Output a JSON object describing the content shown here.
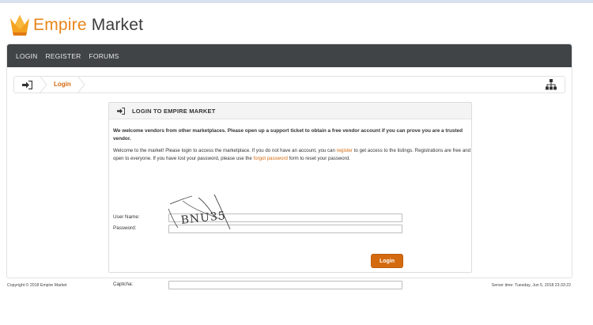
{
  "brand": {
    "name_part1": "Empire",
    "name_part2": "Market",
    "accent_color": "#e8851a"
  },
  "nav": {
    "items": [
      {
        "label": "LOGIN"
      },
      {
        "label": "REGISTER"
      },
      {
        "label": "FORUMS"
      }
    ]
  },
  "breadcrumb": {
    "home_icon": "sign-in-icon",
    "current": "Login",
    "right_icon": "sitemap-icon"
  },
  "panel": {
    "icon": "sign-in-icon",
    "title": "LOGIN TO EMPIRE MARKET",
    "notice": "We welcome vendors from other marketplaces. Please open up a support ticket to obtain a free vendor account if you can prove you are a trusted vendor.",
    "intro_1": "Welcome to the market! Please login to access the marketplace. If you do not have an account, you can ",
    "register_link": "register",
    "intro_2": " to get access to the listings. Registrations are free and open to everyone. If you have lost your password, please use the ",
    "forgot_link": "forgot password",
    "intro_3": " form to reset your password."
  },
  "form": {
    "username_label": "User Name:",
    "username_value": "",
    "password_label": "Password:",
    "password_value": "",
    "captcha_text": "BNU35",
    "captcha_label": "Captcha:",
    "captcha_value": "",
    "submit_label": "Login"
  },
  "footer": {
    "copyright": "Copyright © 2018 Empire Market",
    "server_time": "Server time: Tuesday, Jun 5, 2018 23:33:22"
  },
  "colors": {
    "navbar": "#404447",
    "button": "#d46a10",
    "link": "#d46a10"
  }
}
